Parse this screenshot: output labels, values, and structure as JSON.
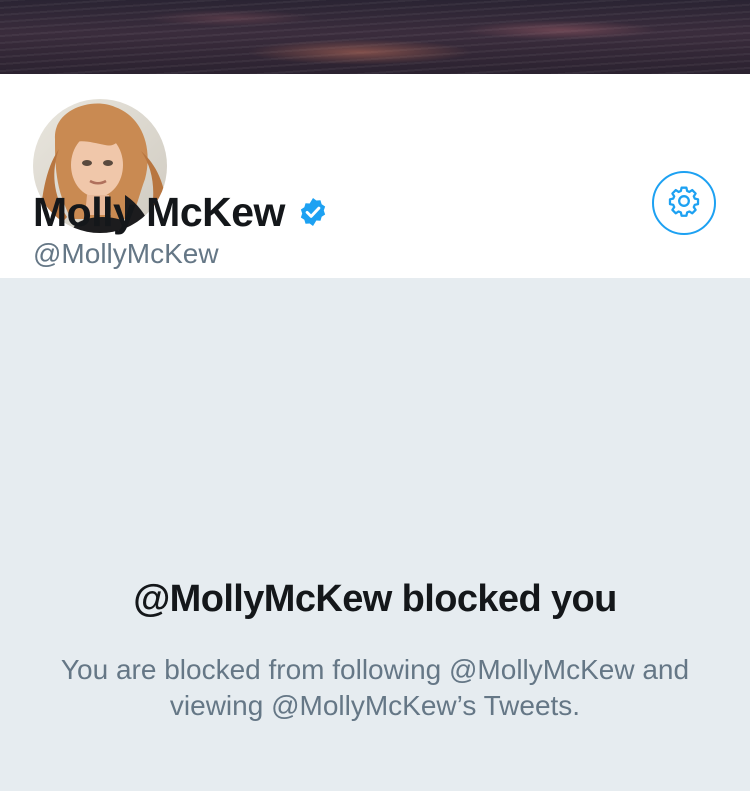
{
  "profile": {
    "display_name": "Molly McKew",
    "handle": "@MollyMcKew",
    "verified": true,
    "avatar_icon": "profile-photo"
  },
  "toolbar": {
    "settings_icon": "gear-icon"
  },
  "blocked_notice": {
    "title": "@MollyMcKew blocked you",
    "message": "You are blocked from following @MollyMcKew and viewing @MollyMcKew’s Tweets."
  },
  "colors": {
    "accent": "#1da1f2",
    "background": "#e6ecf0",
    "primary_text": "#14171a",
    "secondary_text": "#657786"
  }
}
